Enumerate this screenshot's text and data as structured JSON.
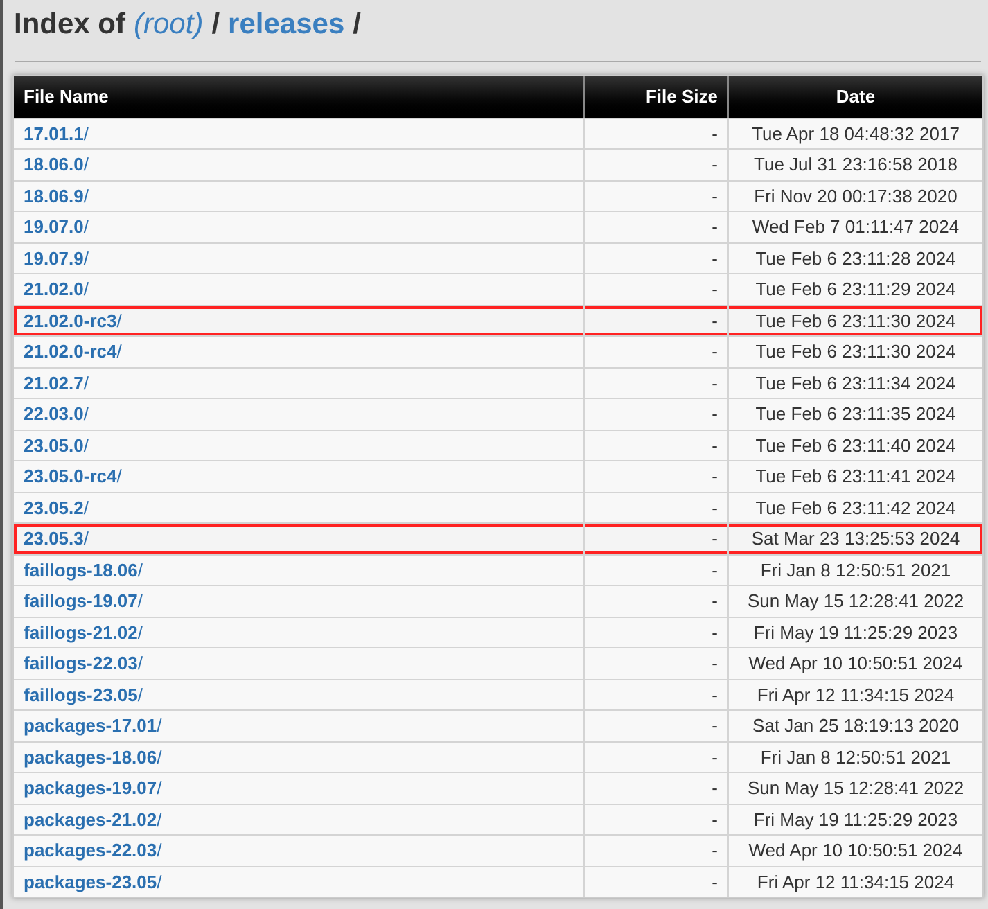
{
  "title": {
    "prefix": "Index of",
    "crumbs": [
      {
        "label": "(root)",
        "italic": true
      },
      {
        "label": "releases",
        "italic": false
      }
    ],
    "separator": "/"
  },
  "table": {
    "columns": [
      "File Name",
      "File Size",
      "Date"
    ],
    "rows": [
      {
        "name": "**17.01.1**/",
        "size": "-",
        "date": "Tue Apr 18 04:48:32 2017",
        "highlighted": false
      },
      {
        "name": "**18.06.0**/",
        "size": "-",
        "date": "Tue Jul 31 23:16:58 2018",
        "highlighted": false
      },
      {
        "name": "**18.06.9**/",
        "size": "-",
        "date": "Fri Nov 20 00:17:38 2020",
        "highlighted": false
      },
      {
        "name": "**19.07.0**/",
        "size": "-",
        "date": "Wed Feb 7 01:11:47 2024",
        "highlighted": false
      },
      {
        "name": "**19.07.9**/",
        "size": "-",
        "date": "Tue Feb 6 23:11:28 2024",
        "highlighted": false
      },
      {
        "name": "**21.02.0**/",
        "size": "-",
        "date": "Tue Feb 6 23:11:29 2024",
        "highlighted": false
      },
      {
        "name": "**21.02.0-rc3**/",
        "size": "-",
        "date": "Tue Feb 6 23:11:30 2024",
        "highlighted": true
      },
      {
        "name": "**21.02.0-rc4**/",
        "size": "-",
        "date": "Tue Feb 6 23:11:30 2024",
        "highlighted": false
      },
      {
        "name": "**21.02.7**/",
        "size": "-",
        "date": "Tue Feb 6 23:11:34 2024",
        "highlighted": false
      },
      {
        "name": "**22.03.0**/",
        "size": "-",
        "date": "Tue Feb 6 23:11:35 2024",
        "highlighted": false
      },
      {
        "name": "**23.05.0**/",
        "size": "-",
        "date": "Tue Feb 6 23:11:40 2024",
        "highlighted": false
      },
      {
        "name": "**23.05.0-rc4**/",
        "size": "-",
        "date": "Tue Feb 6 23:11:41 2024",
        "highlighted": false
      },
      {
        "name": "**23.05.2**/",
        "size": "-",
        "date": "Tue Feb 6 23:11:42 2024",
        "highlighted": false
      },
      {
        "name": "**23.05.3**/",
        "size": "-",
        "date": "Sat Mar 23 13:25:53 2024",
        "highlighted": true
      },
      {
        "name": "**faillogs-18.06**/",
        "size": "-",
        "date": "Fri Jan 8 12:50:51 2021",
        "highlighted": false
      },
      {
        "name": "**faillogs-19.07**/",
        "size": "-",
        "date": "Sun May 15 12:28:41 2022",
        "highlighted": false
      },
      {
        "name": "**faillogs-21.02**/",
        "size": "-",
        "date": "Fri May 19 11:25:29 2023",
        "highlighted": false
      },
      {
        "name": "**faillogs-22.03**/",
        "size": "-",
        "date": "Wed Apr 10 10:50:51 2024",
        "highlighted": false
      },
      {
        "name": "**faillogs-23.05**/",
        "size": "-",
        "date": "Fri Apr 12 11:34:15 2024",
        "highlighted": false
      },
      {
        "name": "**packages-17.01**/",
        "size": "-",
        "date": "Sat Jan 25 18:19:13 2020",
        "highlighted": false
      },
      {
        "name": "**packages-18.06**/",
        "size": "-",
        "date": "Fri Jan 8 12:50:51 2021",
        "highlighted": false
      },
      {
        "name": "**packages-19.07**/",
        "size": "-",
        "date": "Sun May 15 12:28:41 2022",
        "highlighted": false
      },
      {
        "name": "**packages-21.02**/",
        "size": "-",
        "date": "Fri May 19 11:25:29 2023",
        "highlighted": false
      },
      {
        "name": "**packages-22.03**/",
        "size": "-",
        "date": "Wed Apr 10 10:50:51 2024",
        "highlighted": false
      },
      {
        "name": "**packages-23.05**/",
        "size": "-",
        "date": "Fri Apr 12 11:34:15 2024",
        "highlighted": false
      }
    ]
  }
}
